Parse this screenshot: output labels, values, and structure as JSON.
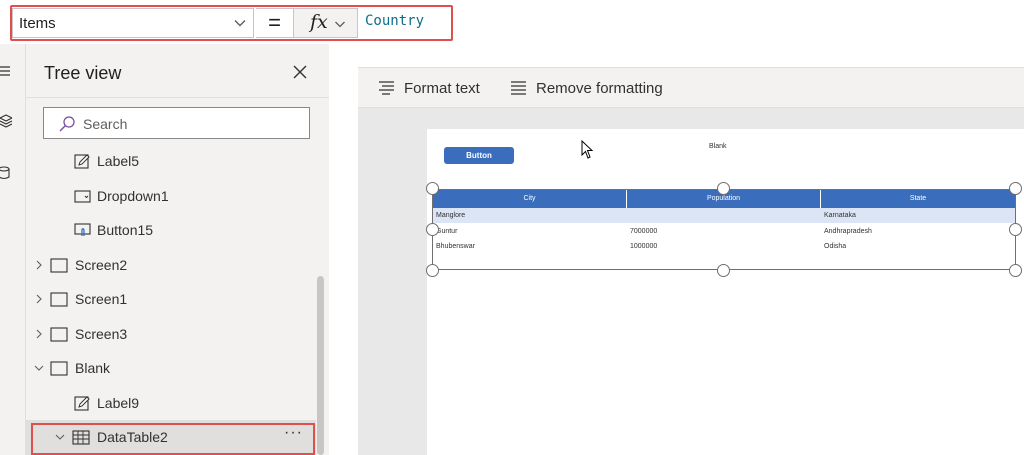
{
  "formula_bar": {
    "property": "Items",
    "equals": "=",
    "fx": "fx",
    "formula": "Country"
  },
  "format_bar": {
    "format_text": "Format text",
    "remove_formatting": "Remove formatting"
  },
  "tree_view": {
    "title": "Tree view",
    "search_placeholder": "Search",
    "items": [
      {
        "label": "Label5"
      },
      {
        "label": "Dropdown1"
      },
      {
        "label": "Button15"
      },
      {
        "label": "Screen2"
      },
      {
        "label": "Screen1"
      },
      {
        "label": "Screen3"
      },
      {
        "label": "Blank"
      },
      {
        "label": "Label9"
      },
      {
        "label": "DataTable2"
      }
    ],
    "more": "···"
  },
  "canvas": {
    "button_label": "Button",
    "blank_label": "Blank",
    "table": {
      "headers": [
        "City",
        "Population",
        "State"
      ],
      "rows": [
        [
          "Manglore",
          "",
          "Karnataka"
        ],
        [
          "Guntur",
          "7000000",
          "Andhrapradesh"
        ],
        [
          "Bhubenswar",
          "1000000",
          "Odisha"
        ]
      ],
      "header_color": "#3a6dbb",
      "selected_row_color": "#dbe5f5"
    }
  },
  "colors": {
    "highlight": "#e04e4e",
    "formula_text": "#0c6f8a"
  }
}
